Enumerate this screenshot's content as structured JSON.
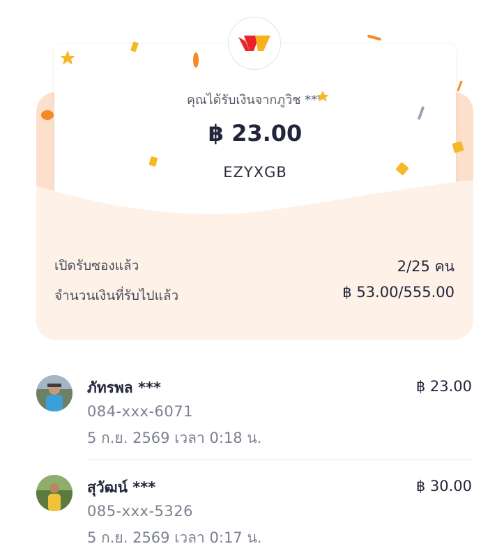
{
  "gift": {
    "sender_line": "คุณได้รับเงินจากภูวิช ***",
    "amount": "฿ 23.00",
    "code": "EZYXGB"
  },
  "stats": [
    {
      "label": "เปิดรับซองแล้ว",
      "value": "2/25 คน"
    },
    {
      "label": "จำนวนเงินที่รับไปแล้ว",
      "value": "฿ 53.00/555.00"
    }
  ],
  "recipients": [
    {
      "name": "ภัทรพล ***",
      "amount": "฿ 23.00",
      "phone": "084-xxx-6071",
      "time": "5 ก.ย. 2569 เวลา 0:18 น."
    },
    {
      "name": "สุวัฒน์ ***",
      "amount": "฿ 30.00",
      "phone": "085-xxx-5326",
      "time": "5 ก.ย. 2569 เวลา 0:17 น."
    }
  ],
  "colors": {
    "envelope": "#fdf1e8",
    "envelope_flap": "#fde0cc",
    "brand_red": "#e8232a",
    "brand_yellow": "#f7b21b",
    "confetti_orange": "#f58a25",
    "confetti_yellow": "#f6b829",
    "confetti_gray": "#9aa3b5"
  }
}
